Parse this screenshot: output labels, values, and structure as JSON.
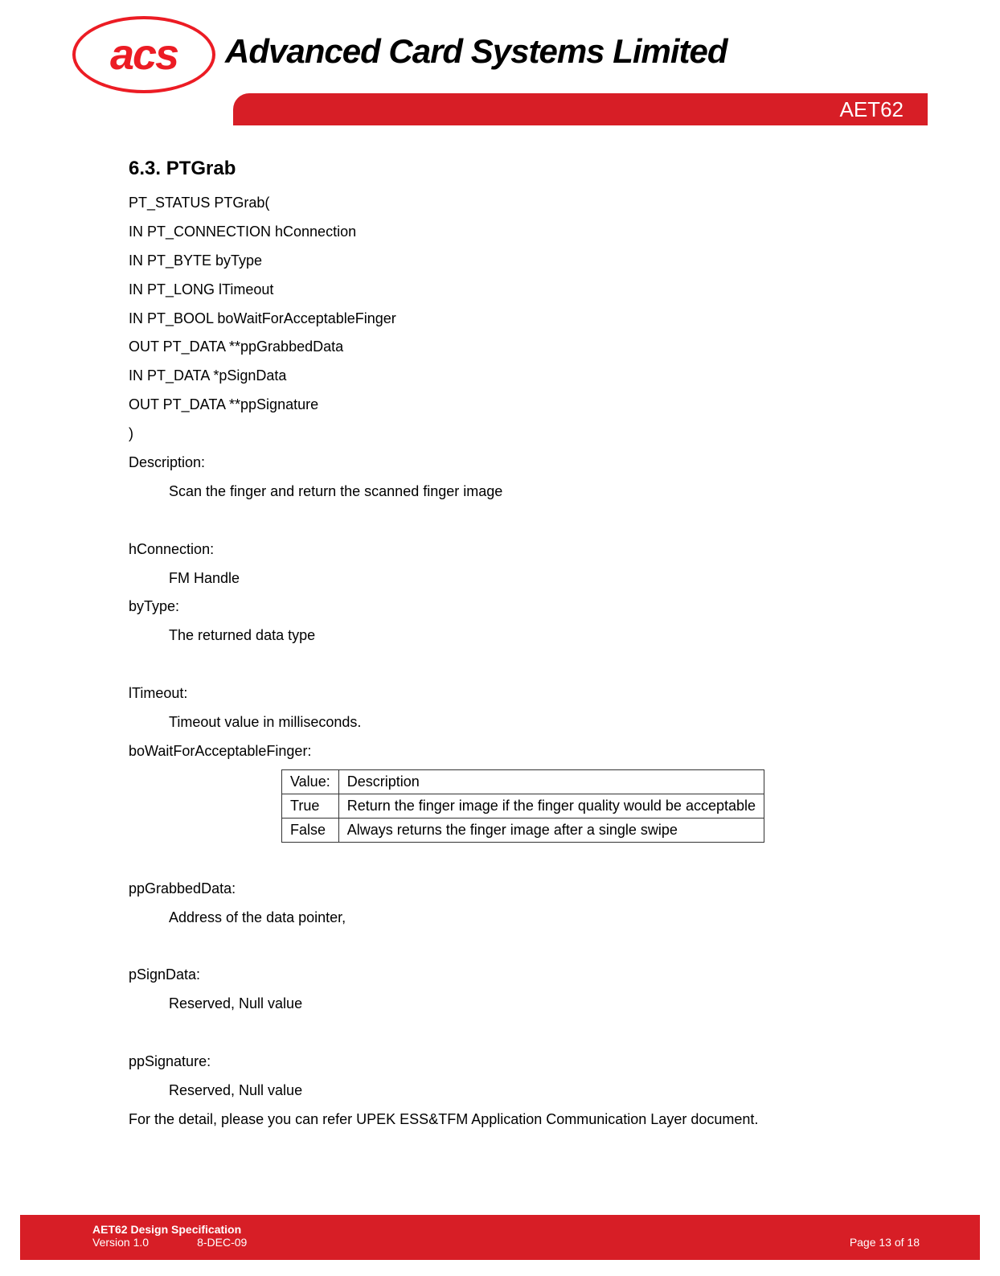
{
  "header": {
    "logo_text": "acs",
    "company_name": "Advanced Card Systems Limited",
    "red_bar_text": "AET62"
  },
  "section": {
    "title": "6.3. PTGrab",
    "signature": [
      "PT_STATUS PTGrab(",
      "IN PT_CONNECTION hConnection",
      "IN PT_BYTE byType",
      "IN PT_LONG lTimeout",
      "IN PT_BOOL boWaitForAcceptableFinger",
      "OUT PT_DATA **ppGrabbedData",
      "IN PT_DATA *pSignData",
      "OUT PT_DATA **ppSignature",
      ")"
    ],
    "description_label": "Description:",
    "description_text": "Scan the finger and return the scanned finger image",
    "params": {
      "hConnection": {
        "label": "hConnection:",
        "text": " FM Handle"
      },
      "byType": {
        "label": "byType:",
        "text": "The returned data type"
      },
      "lTimeout": {
        "label": "lTimeout:",
        "text": "Timeout value in milliseconds."
      },
      "boWait": {
        "label": "boWaitForAcceptableFinger:"
      },
      "ppGrabbedData": {
        "label": "ppGrabbedData:",
        "text": "Address of the data pointer,"
      },
      "pSignData": {
        "label": "pSignData:",
        "text": "Reserved, Null value"
      },
      "ppSignature": {
        "label": "ppSignature:",
        "text": "Reserved, Null value"
      }
    },
    "table": {
      "h1": "Value:",
      "h2": "Description",
      "r1c1": "True",
      "r1c2": "Return the finger image if the finger quality would be acceptable",
      "r2c1": "False",
      "r2c2": "Always returns the finger image after a single swipe"
    },
    "closing": "For the detail, please you can refer UPEK ESS&TFM Application Communication Layer document."
  },
  "footer": {
    "title": "AET62 Design Specification",
    "version": "Version 1.0",
    "date": "8-DEC-09",
    "page": "Page 13 of 18"
  }
}
